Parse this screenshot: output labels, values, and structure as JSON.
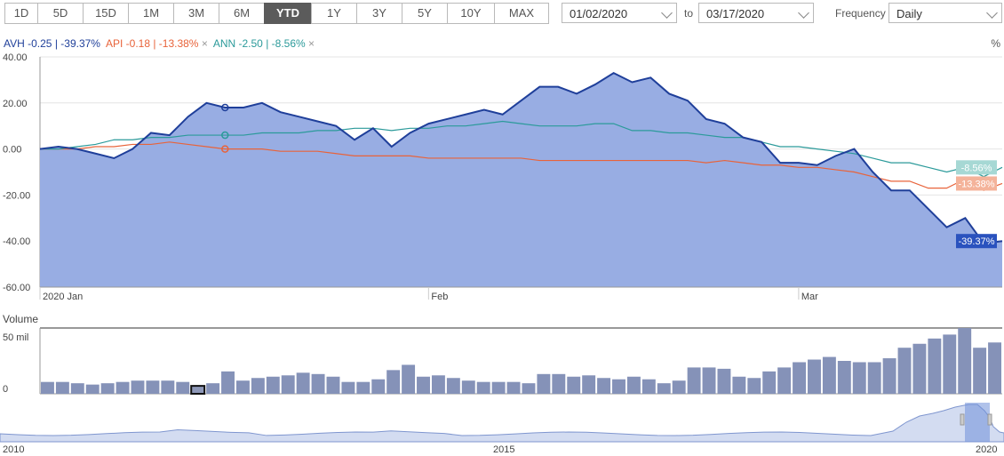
{
  "toolbar": {
    "ranges": [
      "1D",
      "5D",
      "15D",
      "1M",
      "3M",
      "6M",
      "YTD",
      "1Y",
      "3Y",
      "5Y",
      "10Y",
      "MAX"
    ],
    "active": "YTD"
  },
  "date_range": {
    "from": "01/02/2020",
    "to_label": "to",
    "to": "03/17/2020"
  },
  "frequency": {
    "label": "Frequency",
    "value": "Daily"
  },
  "legend": {
    "items": [
      {
        "ticker": "AVH",
        "stats": "-0.25 | -39.37%",
        "color": "#1f3f9a"
      },
      {
        "ticker": "API",
        "stats": "-0.18 | -13.38%",
        "color": "#e8633a",
        "close": "×"
      },
      {
        "ticker": "ANN",
        "stats": "-2.50 | -8.56%",
        "color": "#2b9a9a",
        "close": "×"
      }
    ],
    "unit": "%"
  },
  "chart_data": [
    {
      "type": "area",
      "yticks": [
        "40.00",
        "20.00",
        "0.00",
        "-20.00",
        "-40.00",
        "-60.00"
      ],
      "ylim": [
        -60,
        40
      ],
      "xticks": [
        {
          "label": "2020 Jan",
          "index": 0
        },
        {
          "label": "Feb",
          "index": 21
        },
        {
          "label": "Mar",
          "index": 41
        }
      ],
      "series": [
        {
          "name": "AVH",
          "color": "#1f3f9a",
          "fill": "#98ade3",
          "values": [
            0,
            1,
            0,
            -2,
            -4,
            0,
            7,
            6,
            14,
            20,
            18,
            18,
            20,
            16,
            14,
            12,
            10,
            4,
            9,
            1,
            7,
            11,
            13,
            15,
            17,
            15,
            21,
            27,
            27,
            24,
            28,
            33,
            29,
            31,
            24,
            21,
            13,
            11,
            5,
            3,
            -6,
            -6,
            -7,
            -3,
            0,
            -10,
            -18,
            -18,
            -26,
            -34,
            -30,
            -41,
            -40
          ],
          "last_label": "-39.37%"
        },
        {
          "name": "API",
          "color": "#e8633a",
          "values": [
            0,
            0,
            0,
            1,
            1,
            2,
            2,
            3,
            2,
            1,
            0,
            0,
            0,
            -1,
            -1,
            -1,
            -2,
            -3,
            -3,
            -3,
            -3,
            -4,
            -4,
            -4,
            -4,
            -4,
            -4,
            -5,
            -5,
            -5,
            -5,
            -5,
            -5,
            -5,
            -5,
            -5,
            -6,
            -5,
            -6,
            -7,
            -7,
            -8,
            -8,
            -9,
            -10,
            -12,
            -14,
            -14,
            -17,
            -17,
            -13,
            -18,
            -15
          ],
          "last_label": "-13.38%"
        },
        {
          "name": "ANN",
          "color": "#2b9a9a",
          "values": [
            0,
            0,
            1,
            2,
            4,
            4,
            5,
            5,
            6,
            6,
            6,
            6,
            7,
            7,
            7,
            8,
            8,
            9,
            9,
            8,
            9,
            9,
            10,
            10,
            11,
            12,
            11,
            10,
            10,
            10,
            11,
            11,
            8,
            8,
            7,
            7,
            6,
            5,
            5,
            3,
            1,
            1,
            0,
            -1,
            -2,
            -4,
            -6,
            -6,
            -8,
            -10,
            -8,
            -12,
            -8
          ],
          "last_label": "-8.56%"
        }
      ]
    },
    {
      "type": "bar",
      "title": "Volume",
      "yticks": [
        "50 mil",
        "0"
      ],
      "values": [
        9,
        9,
        8,
        7,
        8,
        9,
        10,
        10,
        10,
        9,
        6,
        8,
        17,
        10,
        12,
        13,
        14,
        16,
        15,
        13,
        9,
        9,
        11,
        18,
        22,
        13,
        14,
        12,
        10,
        9,
        9,
        9,
        8,
        15,
        15,
        13,
        14,
        12,
        11,
        13,
        11,
        8,
        10,
        20,
        20,
        19,
        13,
        12,
        17,
        20,
        24,
        26,
        28,
        25,
        24,
        24,
        27,
        35,
        38,
        42,
        45,
        50,
        35,
        39
      ]
    },
    {
      "type": "area",
      "xticks": [
        "2010",
        "2015",
        "2020"
      ]
    }
  ]
}
